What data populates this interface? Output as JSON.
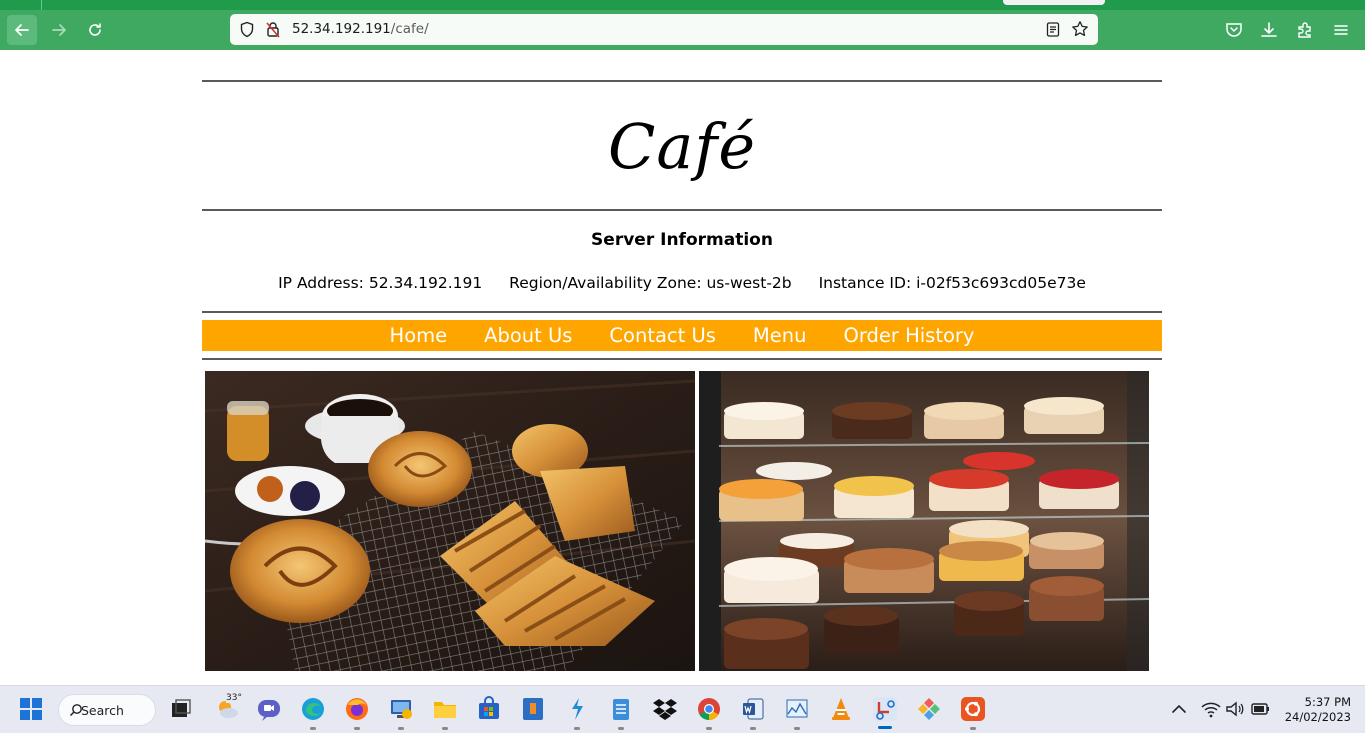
{
  "browser": {
    "url_host": "52.34.192.191",
    "url_path": "/cafe/"
  },
  "page": {
    "title": "Café",
    "server_heading": "Server Information",
    "ip_label": "IP Address: 52.34.192.191",
    "region_label": "Region/Availability Zone: us-west-2b",
    "instance_label": "Instance ID: i-02f53c693cd05e73e",
    "menu": [
      "Home",
      "About Us",
      "Contact Us",
      "Menu",
      "Order History"
    ]
  },
  "taskbar": {
    "search_label": "Search",
    "weather_temp": "33°",
    "time": "5:37 PM",
    "date": "24/02/2023"
  },
  "colors": {
    "browser_chrome": "#3fa962",
    "menu_bar": "#ffa500"
  }
}
